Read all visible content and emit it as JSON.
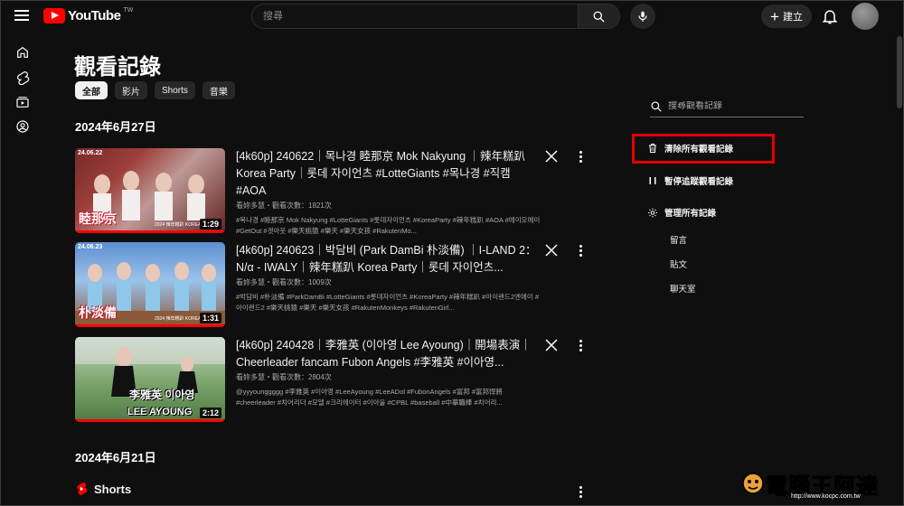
{
  "topbar": {
    "logo_text": "YouTube",
    "logo_region": "TW",
    "search_placeholder": "搜尋",
    "create_label": "建立"
  },
  "guide": [
    "home-icon",
    "shorts-icon",
    "subscriptions-icon",
    "you-icon"
  ],
  "page": {
    "title": "觀看記錄",
    "chips": [
      "全部",
      "影片",
      "Shorts",
      "音樂"
    ],
    "active_chip": "全部"
  },
  "sections": [
    {
      "date": "2024年6月27日",
      "videos": [
        {
          "title": "[4k60p] 240622｜목나경 睦那京 Mok Nakyung ｜辣年糕趴 Korea Party｜롯데 자이언츠 #LotteGiants #목나경 #직캠 #AOA",
          "meta": "看妳多慧・觀看次數：1821次",
          "desc": "#목나경 #睦那京 Mok Nakyung #LotteGiants #롯데자이언츠 #KoreaParty #辣年糕趴 #AOA #에이오에이 #GetOut #겟아웃 #樂天桃猿 #樂天 #樂天女孩 #RakutenMo...",
          "thumb_date": "24.06.22",
          "thumb_text": "睦那京",
          "thumb_sub": "2024 辣年糕趴 KOREA",
          "duration": "1:29",
          "progress": 1.0
        },
        {
          "title": "[4k60p] 240623｜박담비 (Park DamBi 朴淡備) ｜I-LAND 2：N/α - IWALY｜辣年糕趴 Korea Party｜롯데 자이언츠...",
          "meta": "看妳多慧・觀看次數：1009次",
          "desc": "#박담비 #朴淡備 #ParkDamBi #LotteGiants #롯데자이언츠 #KoreaParty #辣年糕趴 #아이랜드2엔에이 #아이랜드2 #樂天桃猿 #樂天 #樂天女孩 #RakutenMonkeys #RakutenGirl...",
          "thumb_date": "24.06.23",
          "thumb_text": "朴淡備",
          "thumb_sub": "2024 辣年糕趴 KOREA",
          "duration": "1:31",
          "progress": 1.0
        },
        {
          "title": "[4k60p] 240428｜李雅英 (이아영 Lee Ayoung)｜開場表演｜Cheerleader fancam Fubon Angels #李雅英 #이아영...",
          "meta": "看妳多慧・觀看次數：2804次",
          "desc": "@yyyounggggg #李雅英 #이아영 #LeeAyoung #LeeADol #FubonAngels #富邦 #富邦悍將 #cheerleader #치어리더 #모델 #크리에이터 #이아울 #CPBL #baseball #中華職棒 #치어리...",
          "thumb_date": "",
          "thumb_text": "李雅英 이아영",
          "thumb_text_2": "LEE AYOUNG",
          "duration": "2:12",
          "progress": 1.0
        }
      ]
    },
    {
      "date": "2024年6月21日",
      "shorts_label": "Shorts"
    }
  ],
  "right_panel": {
    "search_placeholder": "搜尋觀看記錄",
    "actions": [
      {
        "label": "清除所有觀看記錄",
        "icon": "trash-icon"
      },
      {
        "label": "暫停追蹤觀看記錄",
        "icon": "pause-icon"
      },
      {
        "label": "管理所有記錄",
        "icon": "gear-icon"
      }
    ],
    "sub_links": [
      "留言",
      "貼文",
      "聊天室"
    ]
  },
  "watermark": {
    "text": "電腦王阿達",
    "url": "http://www.kocpc.com.tw"
  },
  "colors": {
    "background": "#0f0f0f",
    "brand_red": "#ff0000",
    "highlight_box": "#e60000"
  }
}
